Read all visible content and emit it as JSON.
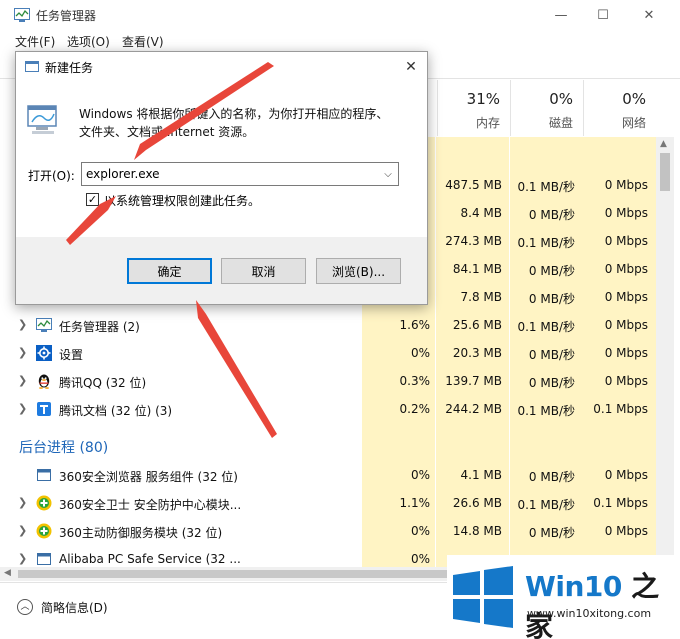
{
  "window": {
    "title": "任务管理器",
    "controls": {
      "minimize": "—",
      "maximize": "☐",
      "close": "✕"
    }
  },
  "menu": [
    "文件(F)",
    "选项(O)",
    "查看(V)"
  ],
  "columns": [
    {
      "pct": "31%",
      "label": "内存"
    },
    {
      "pct": "0%",
      "label": "磁盘"
    },
    {
      "pct": "0%",
      "label": "网络"
    }
  ],
  "colors": {
    "highlight": "#fff4c4",
    "accent": "#1e66b8",
    "arrow": "#e8463a"
  },
  "rows_top": [
    {
      "mem": "487.5 MB",
      "disk": "0.1 MB/秒",
      "net": "0 Mbps"
    },
    {
      "mem": "8.4 MB",
      "disk": "0 MB/秒",
      "net": "0 Mbps"
    },
    {
      "mem": "274.3 MB",
      "disk": "0.1 MB/秒",
      "net": "0 Mbps"
    },
    {
      "mem": "84.1 MB",
      "disk": "0 MB/秒",
      "net": "0 Mbps"
    },
    {
      "mem": "7.8 MB",
      "disk": "0 MB/秒",
      "net": "0 Mbps"
    }
  ],
  "apps": [
    {
      "name": "任务管理器 (2)",
      "icon": "taskmgr-icon",
      "cpu": "1.6%",
      "mem": "25.6 MB",
      "disk": "0.1 MB/秒",
      "net": "0 Mbps"
    },
    {
      "name": "设置",
      "icon": "gear-icon",
      "cpu": "0%",
      "mem": "20.3 MB",
      "disk": "0 MB/秒",
      "net": "0 Mbps"
    },
    {
      "name": "腾讯QQ (32 位)",
      "icon": "qq-penguin-icon",
      "cpu": "0.3%",
      "mem": "139.7 MB",
      "disk": "0 MB/秒",
      "net": "0 Mbps"
    },
    {
      "name": "腾讯文档 (32 位) (3)",
      "icon": "tencent-docs-icon",
      "cpu": "0.2%",
      "mem": "244.2 MB",
      "disk": "0.1 MB/秒",
      "net": "0.1 Mbps"
    }
  ],
  "background_title": "后台进程 (80)",
  "background": [
    {
      "name": "360安全浏览器 服务组件 (32 位)",
      "icon": "window-icon",
      "cpu": "0%",
      "mem": "4.1 MB",
      "disk": "0 MB/秒",
      "net": "0 Mbps"
    },
    {
      "name": "360安全卫士 安全防护中心模块...",
      "icon": "shield-plus-icon",
      "cpu": "1.1%",
      "mem": "26.6 MB",
      "disk": "0.1 MB/秒",
      "net": "0.1 Mbps"
    },
    {
      "name": "360主动防御服务模块 (32 位)",
      "icon": "shield-plus-icon",
      "cpu": "0%",
      "mem": "14.8 MB",
      "disk": "0 MB/秒",
      "net": "0 Mbps"
    },
    {
      "name": "Alibaba PC Safe Service (32 ...",
      "icon": "window-icon",
      "cpu": "0%",
      "mem": "",
      "disk": "",
      "net": ""
    }
  ],
  "footer": {
    "fewer_details": "简略信息(D)"
  },
  "dialog": {
    "title": "新建任务",
    "description": "Windows 将根据你所键入的名称，为你打开相应的程序、文件夹、文档或 Internet 资源。",
    "open_label": "打开(O):",
    "input_value": "explorer.exe",
    "checkbox_label": "以系统管理权限创建此任务。",
    "checkbox_checked": true,
    "ok": "确定",
    "cancel": "取消",
    "browse": "浏览(B)..."
  },
  "watermark": {
    "brand_a": "Win10",
    "brand_b": " 之家",
    "url": "www.win10xitong.com"
  }
}
